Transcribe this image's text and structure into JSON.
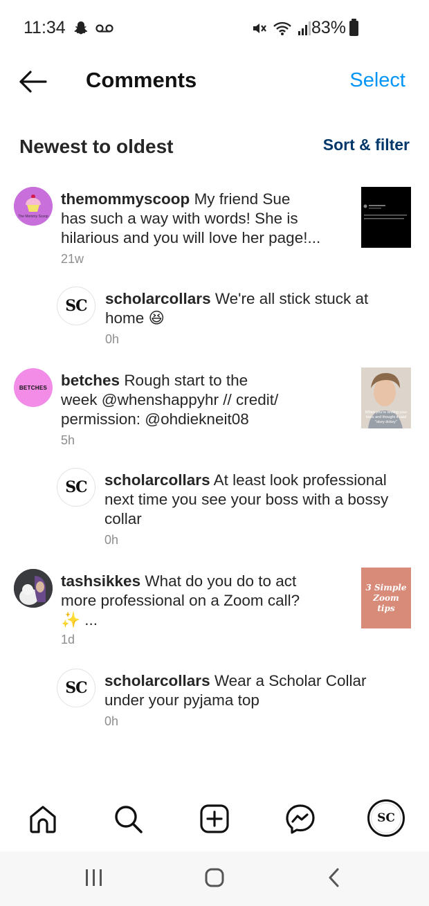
{
  "status": {
    "time": "11:34",
    "battery": "83%"
  },
  "header": {
    "title": "Comments",
    "select_label": "Select"
  },
  "sort": {
    "title": "Newest to oldest",
    "filter_label": "Sort & filter"
  },
  "comments": [
    {
      "username": "themommyscoop",
      "text_lines": [
        "My friend Sue",
        "has such a way with words! She is",
        "hilarious and you will love her page!..."
      ],
      "time": "21w",
      "avatar_caption": "The Mommy Scoop",
      "reply": {
        "username": "scholarcollars",
        "text_lines": [
          "We're all stick stuck at",
          "home 😆"
        ],
        "time": "0h"
      }
    },
    {
      "username": "betches",
      "text_lines": [
        "Rough start to the",
        "week @whenshappyhr // credit/",
        "permission: @ohdiekneit08"
      ],
      "time": "5h",
      "avatar_caption": "BETCHES",
      "thumb_caption": "When you're texting your boss and thought it said \"okey dokey\"",
      "reply": {
        "username": "scholarcollars",
        "text_lines": [
          "At least look professional",
          "next time you see your boss with a bossy",
          "collar"
        ],
        "time": "0h"
      }
    },
    {
      "username": "tashsikkes",
      "text_lines": [
        "What do you do to act",
        "more professional on a Zoom call?",
        "✨ ..."
      ],
      "time": "1d",
      "thumb_caption": "3 Simple Zoom tips",
      "reply": {
        "username": "scholarcollars",
        "text_lines": [
          "Wear a Scholar Collar",
          "under your pyjama top"
        ],
        "time": "0h"
      }
    }
  ],
  "sc_monogram": "SC",
  "colors": {
    "link_blue": "#0095f6",
    "sort_filter": "#00376b",
    "muted": "#8e8e8e",
    "betches_pink": "#f28ce6",
    "thumb_salmon": "#d98b7a"
  },
  "icons": {
    "status": [
      "snapchat-icon",
      "voicemail-icon",
      "mute-icon",
      "wifi-icon",
      "signal-icon",
      "battery-icon"
    ],
    "bottom_nav": [
      "home-icon",
      "search-icon",
      "create-icon",
      "messenger-icon",
      "profile-avatar"
    ],
    "system_nav": [
      "recents-icon",
      "home-circle-icon",
      "back-chevron-icon"
    ]
  }
}
